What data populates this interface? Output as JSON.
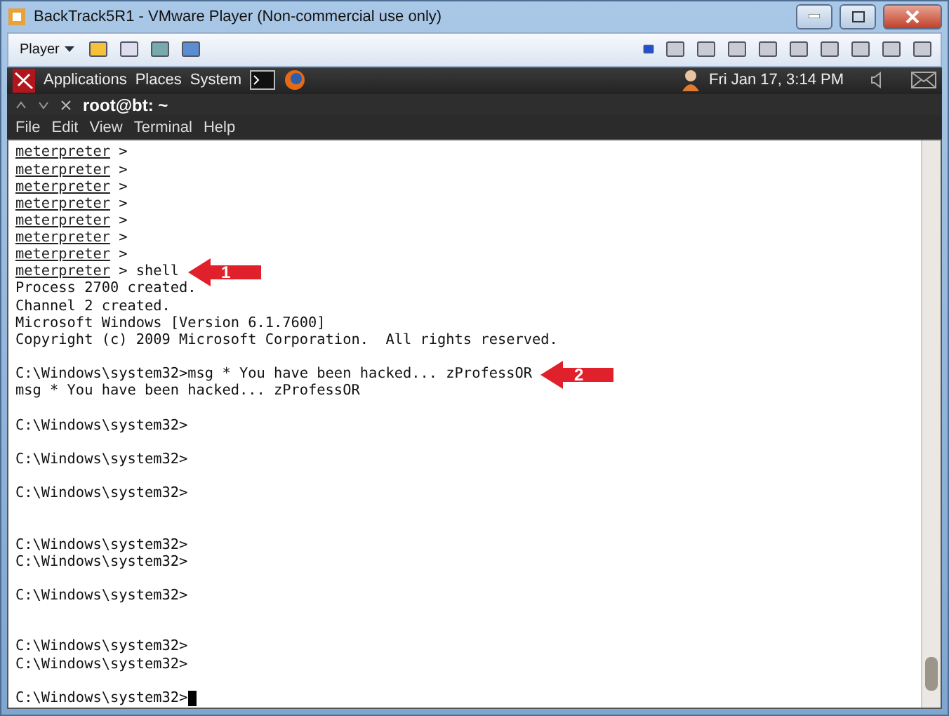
{
  "window": {
    "title": "BackTrack5R1 - VMware Player (Non-commercial use only)"
  },
  "player_toolbar": {
    "menu": "Player"
  },
  "panel": {
    "menus": [
      "Applications",
      "Places",
      "System"
    ],
    "clock": "Fri Jan 17,  3:14 PM"
  },
  "terminal": {
    "title": "root@bt: ~",
    "menus": [
      "File",
      "Edit",
      "View",
      "Terminal",
      "Help"
    ],
    "lines": [
      {
        "kind": "meterpreter",
        "prompt": "meterpreter",
        "text": " >"
      },
      {
        "kind": "meterpreter",
        "prompt": "meterpreter",
        "text": " >"
      },
      {
        "kind": "meterpreter",
        "prompt": "meterpreter",
        "text": " >"
      },
      {
        "kind": "meterpreter",
        "prompt": "meterpreter",
        "text": " >"
      },
      {
        "kind": "meterpreter",
        "prompt": "meterpreter",
        "text": " >"
      },
      {
        "kind": "meterpreter",
        "prompt": "meterpreter",
        "text": " >"
      },
      {
        "kind": "meterpreter",
        "prompt": "meterpreter",
        "text": " >"
      },
      {
        "kind": "meterpreter",
        "prompt": "meterpreter",
        "text": " > shell",
        "callout": "1"
      },
      {
        "kind": "text",
        "text": "Process 2700 created."
      },
      {
        "kind": "text",
        "text": "Channel 2 created."
      },
      {
        "kind": "text",
        "text": "Microsoft Windows [Version 6.1.7600]"
      },
      {
        "kind": "text",
        "text": "Copyright (c) 2009 Microsoft Corporation.  All rights reserved."
      },
      {
        "kind": "blank"
      },
      {
        "kind": "text",
        "text": "C:\\Windows\\system32>msg * You have been hacked... zProfessOR",
        "callout": "2"
      },
      {
        "kind": "text",
        "text": "msg * You have been hacked... zProfessOR"
      },
      {
        "kind": "blank"
      },
      {
        "kind": "text",
        "text": "C:\\Windows\\system32>"
      },
      {
        "kind": "blank"
      },
      {
        "kind": "text",
        "text": "C:\\Windows\\system32>"
      },
      {
        "kind": "blank"
      },
      {
        "kind": "text",
        "text": "C:\\Windows\\system32>"
      },
      {
        "kind": "blank"
      },
      {
        "kind": "blank"
      },
      {
        "kind": "text",
        "text": "C:\\Windows\\system32>"
      },
      {
        "kind": "text",
        "text": "C:\\Windows\\system32>"
      },
      {
        "kind": "blank"
      },
      {
        "kind": "text",
        "text": "C:\\Windows\\system32>"
      },
      {
        "kind": "blank"
      },
      {
        "kind": "blank"
      },
      {
        "kind": "text",
        "text": "C:\\Windows\\system32>"
      },
      {
        "kind": "text",
        "text": "C:\\Windows\\system32>"
      },
      {
        "kind": "blank"
      },
      {
        "kind": "text",
        "text": "C:\\Windows\\system32>",
        "cursor": true
      }
    ]
  }
}
